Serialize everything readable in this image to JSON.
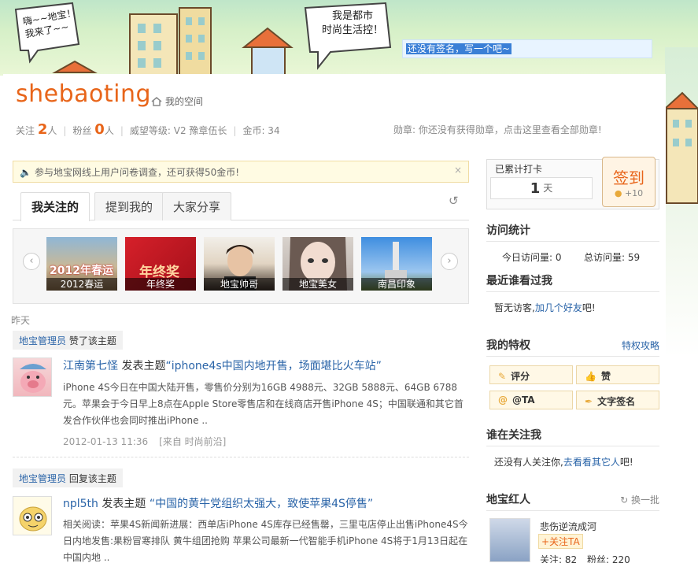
{
  "banner": {
    "cloud_left": "嗨~~地宝！\n我来了~~",
    "cloud_right": "我是都市\n时尚生活控！",
    "signature": "还没有签名，写一个吧~"
  },
  "profile": {
    "username": "shebaoting",
    "myspace": "我的空间",
    "follow_label": "关注",
    "follow_count": "2",
    "follow_unit": "人",
    "fans_label": "粉丝",
    "fans_count": "0",
    "fans_unit": "人",
    "prestige": "威望等级: V2 豫章伍长",
    "coins": "金币: 34",
    "medal": "勋章: 你还没有获得勋章，点击这里查看全部勋章!"
  },
  "notice": {
    "text": "参与地宝网线上用户问卷调查，还可获得50金币!",
    "close": "×"
  },
  "tabs": [
    {
      "label": "我关注的"
    },
    {
      "label": "提到我的"
    },
    {
      "label": "大家分享"
    }
  ],
  "carousel": {
    "prev": "‹",
    "next": "›",
    "items": [
      {
        "caption": "2012春运",
        "overlay": "2012年春运"
      },
      {
        "caption": "年终奖",
        "overlay": "年终奖"
      },
      {
        "caption": "地宝帅哥"
      },
      {
        "caption": "地宝美女"
      },
      {
        "caption": "南昌印象"
      }
    ]
  },
  "feed": {
    "day_label": "昨天",
    "items": [
      {
        "tag_user": "地宝管理员",
        "tag_action": "赞了该主题",
        "author": "江南第七怪",
        "action": "发表主题",
        "topic": "“iphone4s中国内地开售，场面堪比火车站”",
        "body": "iPhone 4S今日在中国大陆开售，零售价分别为16GB 4988元、32GB 5888元、64GB 6788元。苹果会于今日早上8点在Apple Store零售店和在线商店开售iPhone 4S；中国联通和其它首发合作伙伴也会同时推出iPhone ..",
        "date": "2012-01-13 11:36",
        "source": "[来自 时尚前沿]"
      },
      {
        "tag_user": "地宝管理员",
        "tag_action": "回复该主题",
        "author": "npl5th",
        "action": "发表主题",
        "topic": "“中国的黄牛党组织太强大，致使苹果4S停售”",
        "body": "相关阅读：苹果4S新闻新进展：西单店iPhone 4S库存已经售罄，三里屯店停止出售iPhone4S今日内地发售:果粉冒寒排队 黄牛组团抢购      苹果公司最新一代智能手机iPhone 4S将于1月13日起在中国内地 .."
      }
    ]
  },
  "sidebar": {
    "checkin_label": "已累计打卡",
    "checkin_days": "1",
    "checkin_unit": "天",
    "sign_button": "签到",
    "sign_points": "+10",
    "visit_title": "访问统计",
    "visit_today": "今日访问量: 0",
    "visit_total": "总访问量: 59",
    "recent_title": "最近谁看过我",
    "recent_text": "暂无访客,",
    "recent_link": "加几个好友",
    "recent_tail": "吧!",
    "priv_title": "我的特权",
    "priv_link": "特权攻略",
    "privileges": [
      {
        "label": "评分",
        "icon": "rate-icon"
      },
      {
        "label": "赞",
        "icon": "like-icon"
      },
      {
        "label": "@TA",
        "icon": "at-icon"
      },
      {
        "label": "文字签名",
        "icon": "pen-icon"
      }
    ],
    "followers_title": "谁在关注我",
    "followers_text": "还没有人关注你,",
    "followers_link": "去看看其它人",
    "followers_tail": "吧!",
    "stars_title": "地宝红人",
    "stars_refresh": "换一批",
    "star": {
      "name": "悲伤逆流成河",
      "follow_btn": "+关注TA",
      "follows": "关注: 82",
      "fans": "粉丝: 220"
    }
  }
}
